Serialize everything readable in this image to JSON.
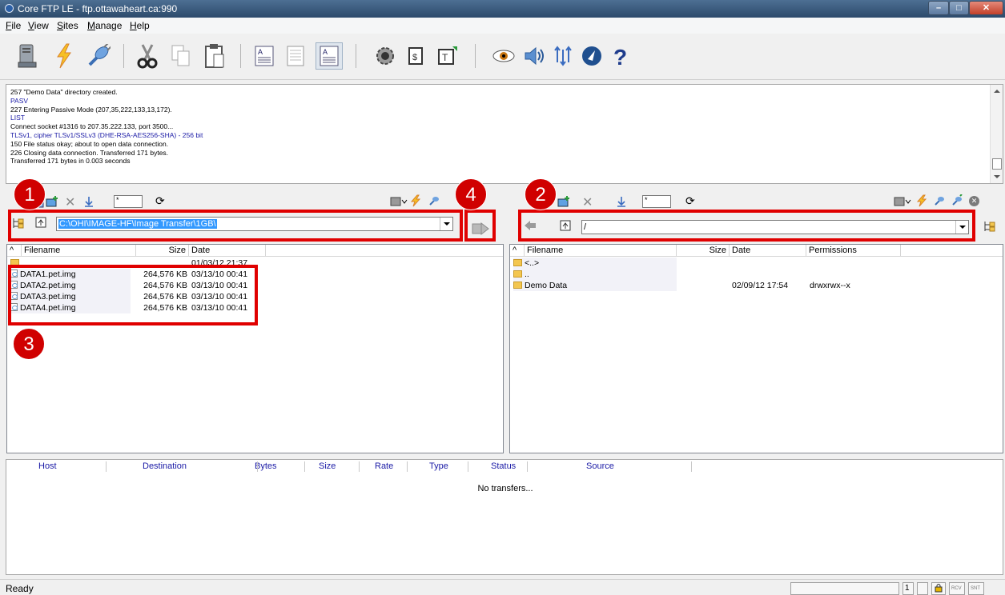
{
  "window": {
    "title": "Core FTP LE - ftp.ottawaheart.ca:990"
  },
  "menu": [
    "File",
    "View",
    "Sites",
    "Manage",
    "Help"
  ],
  "toolbar_icons": [
    "connect-icon",
    "quick-connect-icon",
    "disconnect-icon",
    "cut-icon",
    "copy-icon",
    "paste-icon",
    "view-ascii-icon",
    "view-binary-icon",
    "view-auto-icon",
    "settings-icon",
    "sites-icon",
    "transfer-type-icon",
    "view-icon",
    "sound-icon",
    "sync-icon",
    "about-icon",
    "help-icon"
  ],
  "log": [
    {
      "text": "257 \"Demo Data\" directory created.",
      "blue": false
    },
    {
      "text": "PASV",
      "blue": true
    },
    {
      "text": "227 Entering Passive Mode (207,35,222,133,13,172).",
      "blue": false
    },
    {
      "text": "LIST",
      "blue": true
    },
    {
      "text": "Connect socket #1316 to 207.35.222.133, port 3500...",
      "blue": false
    },
    {
      "text": "TLSv1, cipher TLSv1/SSLv3 (DHE-RSA-AES256-SHA) - 256 bit",
      "blue": true
    },
    {
      "text": "150 File status okay; about to open data connection.",
      "blue": false
    },
    {
      "text": "226 Closing data connection. Transferred 171 bytes.",
      "blue": false
    },
    {
      "text": "Transferred 171 bytes in 0.003 seconds",
      "blue": false
    }
  ],
  "local": {
    "filter_value": "*",
    "path": "C:\\OHI\\IMAGE-HF\\Image Transfer\\1GB\\",
    "columns": {
      "sort": "^",
      "filename": "Filename",
      "size": "Size",
      "date": "Date"
    },
    "rows": [
      {
        "name": "",
        "size": "",
        "date": "01/03/12  21:37",
        "type": "folder"
      },
      {
        "name": "DATA1.pet.img",
        "size": "264,576 KB",
        "date": "03/13/10  00:41",
        "type": "file"
      },
      {
        "name": "DATA2.pet.img",
        "size": "264,576 KB",
        "date": "03/13/10  00:41",
        "type": "file"
      },
      {
        "name": "DATA3.pet.img",
        "size": "264,576 KB",
        "date": "03/13/10  00:41",
        "type": "file"
      },
      {
        "name": "DATA4.pet.img",
        "size": "264,576 KB",
        "date": "03/13/10  00:41",
        "type": "file"
      }
    ]
  },
  "remote": {
    "filter_value": "*",
    "path": "/",
    "columns": {
      "sort": "^",
      "filename": "Filename",
      "size": "Size",
      "date": "Date",
      "permissions": "Permissions"
    },
    "rows": [
      {
        "name": "<..>",
        "date": "",
        "perm": "",
        "type": "folder"
      },
      {
        "name": "..",
        "date": "",
        "perm": "",
        "type": "folder"
      },
      {
        "name": "Demo Data",
        "date": "02/09/12  17:54",
        "perm": "drwxrwx--x",
        "type": "folder"
      }
    ]
  },
  "transfer": {
    "columns": [
      "Host",
      "Destination",
      "Bytes",
      "Size",
      "Rate",
      "Type",
      "Status",
      "Source"
    ],
    "empty_text": "No transfers..."
  },
  "status": {
    "text": "Ready",
    "page": "1",
    "rcv": "RCV",
    "snt": "SNT"
  },
  "annotations": [
    "1",
    "2",
    "3",
    "4"
  ],
  "colors": {
    "highlight": "#e00000",
    "selection": "#3399ff",
    "log_blue": "#1a1aa6"
  }
}
